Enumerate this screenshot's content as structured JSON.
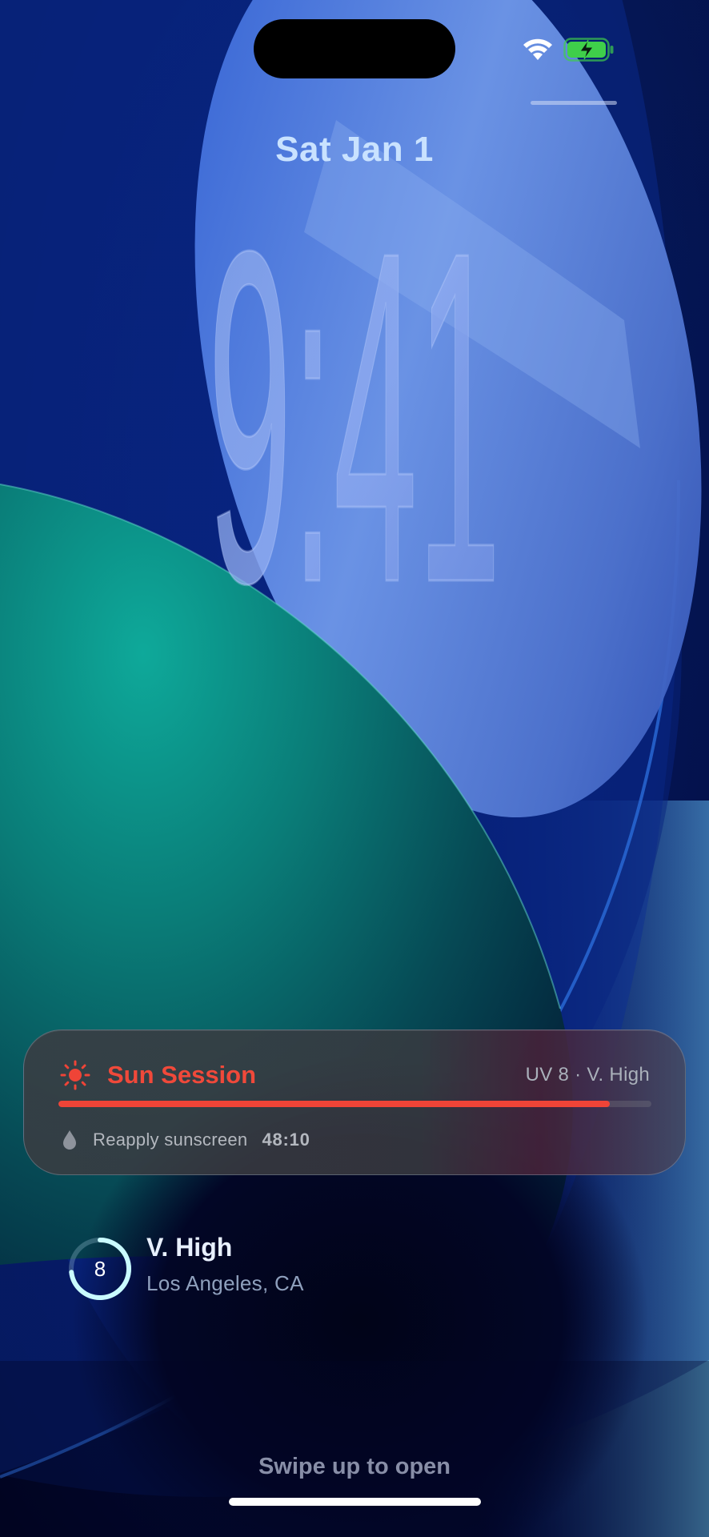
{
  "status_bar": {
    "wifi_icon": "wifi-icon",
    "battery_icon": "battery-charging-icon",
    "battery_color": "#3fcf4a"
  },
  "lock_screen": {
    "date": "Sat Jan 1",
    "time": "9:41"
  },
  "live_activity": {
    "icon": "sun-icon",
    "title": "Sun Session",
    "uv_label": "UV 8 · V. High",
    "progress": 0.93,
    "reminder_icon": "drop-icon",
    "reminder_text": "Reapply sunscreen",
    "timer": "48:10",
    "accent_color": "#ef4437"
  },
  "widget": {
    "uv_value": "8",
    "uv_level": "V. High",
    "location": "Los Angeles, CA",
    "ring_fraction": 0.73,
    "ring_color": "#c9fbff"
  },
  "footer": {
    "swipe_text": "Swipe up to open"
  }
}
